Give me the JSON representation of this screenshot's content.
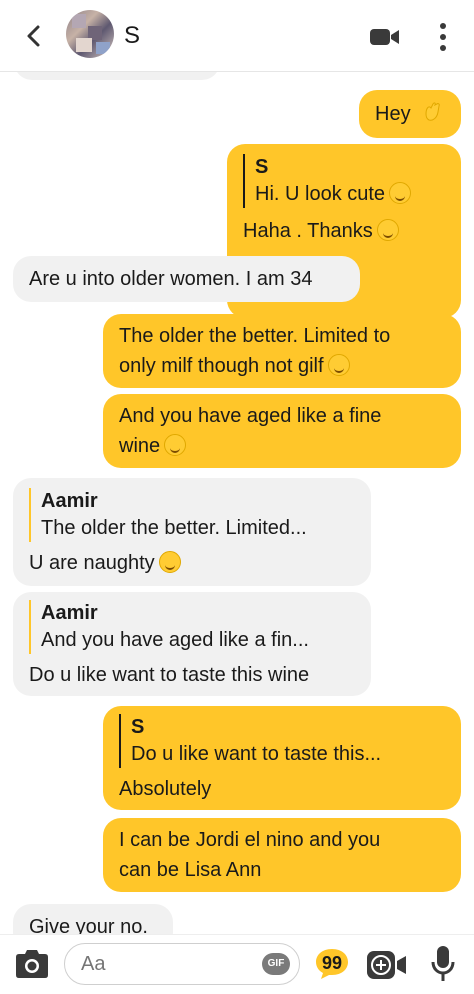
{
  "header": {
    "contact_name": "S",
    "icons": {
      "back": "chevron-left-icon",
      "video": "video-camera-icon",
      "more": "more-vertical-icon"
    }
  },
  "messages": [
    {
      "id": "m1",
      "side": "outgoing",
      "text": "Hey",
      "emoji": "waving-hand"
    },
    {
      "id": "m2",
      "side": "outgoing",
      "quote_name": "S",
      "quote_text": "Hi. U look cute",
      "quote_emoji": "star-struck",
      "text": "Haha . Thanks",
      "emoji": "smiling-face"
    },
    {
      "id": "m3",
      "side": "incoming",
      "text": "Are u into older women. I am 34"
    },
    {
      "id": "m4",
      "side": "outgoing",
      "text_line1": "The older the better. Limited to",
      "text_line2": "only milf though not gilf",
      "emoji": "grinning-sweat"
    },
    {
      "id": "m5",
      "side": "outgoing",
      "text_line1": "And you have aged like a fine",
      "text_line2": "wine",
      "emoji": "drooling-face"
    },
    {
      "id": "m6",
      "side": "incoming",
      "quote_name": "Aamir",
      "quote_text": "The older the better. Limited...",
      "text": "U are naughty",
      "emoji": "grinning-face"
    },
    {
      "id": "m7",
      "side": "incoming",
      "quote_name": "Aamir",
      "quote_text": "And you have aged like a fin...",
      "text": "Do u like want to taste this wine"
    },
    {
      "id": "m8",
      "side": "outgoing",
      "quote_name": "S",
      "quote_text": "Do u like want to taste this...",
      "text": "Absolutely"
    },
    {
      "id": "m9",
      "side": "outgoing",
      "text_line1": "I can be Jordi el nino and you",
      "text_line2": "can be Lisa Ann"
    },
    {
      "id": "m10",
      "side": "incoming",
      "text": "Give your no."
    }
  ],
  "composer": {
    "placeholder": "Aa",
    "gif_label": "GIF",
    "icons": {
      "camera": "camera-icon",
      "quote": "speech-bubble-icon",
      "game": "game-icon",
      "mic": "microphone-icon"
    }
  },
  "colors": {
    "accent": "#ffc629",
    "incoming_bubble": "#f1f1f1",
    "text": "#1a1a1a"
  }
}
